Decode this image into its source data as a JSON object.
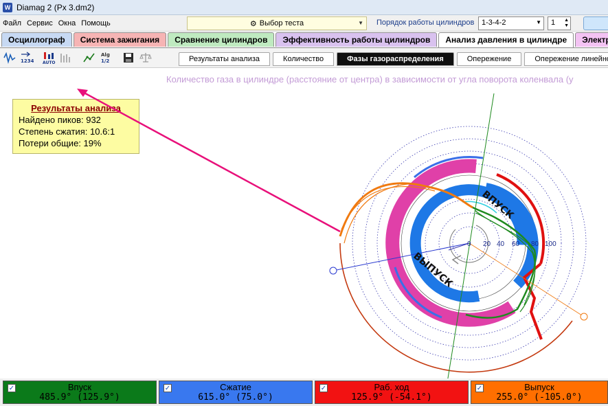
{
  "window": {
    "title": "Diamag 2 (Px 3.dm2)"
  },
  "menu": [
    "Файл",
    "Сервис",
    "Окна",
    "Помощь"
  ],
  "test_select": {
    "value": "Выбор теста"
  },
  "cylinder_order": {
    "label": "Порядок работы цилиндров",
    "value": "1-3-4-2",
    "cylinder": "1"
  },
  "main_tabs": [
    {
      "label": "Осциллограф",
      "color": "#c7d9f3"
    },
    {
      "label": "Система зажигания",
      "color": "#f6b4b4"
    },
    {
      "label": "Сравнение цилиндров",
      "color": "#bfeac0"
    },
    {
      "label": "Эффективность работы цилиндров",
      "color": "#d9c2ef"
    },
    {
      "label": "Анализ давления в цилиндре",
      "color": "#ffffff"
    },
    {
      "label": "Электропи",
      "color": "#f3c3f3"
    }
  ],
  "toolbar_icons": [
    "waveform-icon",
    "counter-1234-icon",
    "auto-scale-icon",
    "levels-icon",
    "trend-icon",
    "algo-icon",
    "save-icon",
    "scales-icon"
  ],
  "sub_tabs": [
    "Результаты анализа",
    "Количество",
    "Фазы газораспределения",
    "Опережение",
    "Опережение линейно"
  ],
  "chart_title": "Количество газа в цилиндре (расстояние от центра) в зависимости от угла поворота коленвала (у",
  "results": {
    "title": "Результаты анализа",
    "peaks": "Найдено пиков: 932",
    "compression": "Степень сжатия: 10.6:1",
    "losses": "Потери общие: 19%"
  },
  "polar": {
    "radial_ticks": [
      "0",
      "20",
      "40",
      "60",
      "80",
      "100"
    ],
    "labels": {
      "intake": "ВПУСК",
      "exhaust": "ВЫПУСК"
    },
    "colors": {
      "intake": "#1e8a1e",
      "compression": "#3a6fe8",
      "power": "#e01010",
      "exhaust": "#f07a10",
      "ring_magenta": "#e040a8",
      "ring_blue": "#1e78e6"
    }
  },
  "phases": [
    {
      "name": "Впуск",
      "value": "485.9° (125.9°)",
      "color": "#0b7a1a"
    },
    {
      "name": "Сжатие",
      "value": "615.0° (75.0°)",
      "color": "#3978ef"
    },
    {
      "name": "Раб. ход",
      "value": "125.9° (-54.1°)",
      "color": "#f21212"
    },
    {
      "name": "Выпуск",
      "value": "255.0° (-105.0°)",
      "color": "#ff6f00"
    }
  ]
}
